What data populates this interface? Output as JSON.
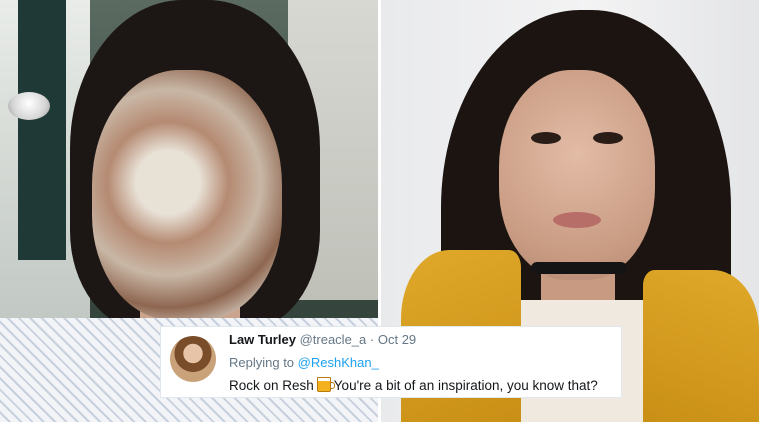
{
  "tweet": {
    "display_name": "Law Turley",
    "handle": "@treacle_a",
    "separator": "·",
    "date": "Oct 29",
    "replying_prefix": "Replying to",
    "replying_to": "@ReshKhan_",
    "text_before_emoji": "Rock on Resh",
    "emoji": "beer-mug-icon",
    "text_after_emoji": "You're a bit of an inspiration, you know that?"
  },
  "icons": {
    "avatar": "avatar"
  },
  "colors": {
    "link": "#1da1f2",
    "muted": "#657786",
    "text": "#14171a"
  }
}
